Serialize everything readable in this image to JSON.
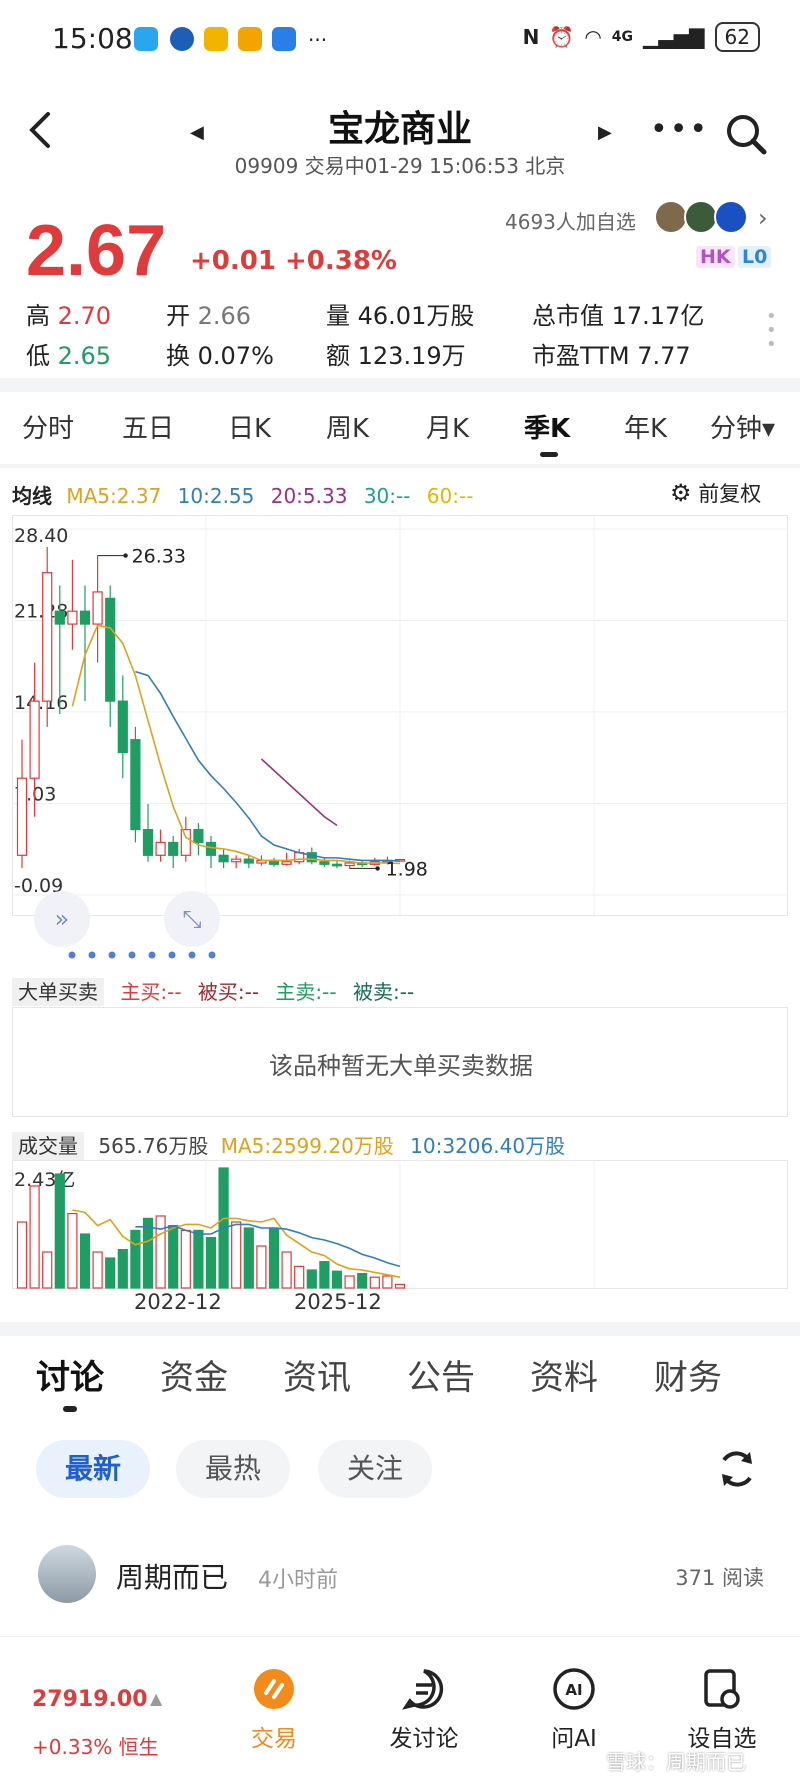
{
  "status": {
    "time": "15:08",
    "network": "4G",
    "battery": "62"
  },
  "header": {
    "title": "宝龙商业",
    "subtitle": "09909 交易中01-29 15:06:53 北京"
  },
  "quote": {
    "price": "2.67",
    "change": "+0.01 +0.38%",
    "followers": "4693人加自选",
    "badges": [
      "HK",
      "L0"
    ],
    "stats": {
      "high_label": "高",
      "high": "2.70",
      "open_label": "开",
      "open": "2.66",
      "volume_label": "量",
      "volume": "46.01万股",
      "mktcap_label": "总市值",
      "mktcap": "17.17亿",
      "low_label": "低",
      "low": "2.65",
      "turnover_label": "换",
      "turnover": "0.07%",
      "amount_label": "额",
      "amount": "123.19万",
      "pe_label": "市盈TTM",
      "pe": "7.77"
    }
  },
  "period_tabs": [
    "分时",
    "五日",
    "日K",
    "周K",
    "月K",
    "季K",
    "年K",
    "分钟▾"
  ],
  "active_period": "季K",
  "ma_legend": {
    "title": "均线",
    "ma5": "MA5:2.37",
    "ma10": "10:2.55",
    "ma20": "20:5.33",
    "ma30": "30:--",
    "ma60": "60:--",
    "adjust": "前复权"
  },
  "colors": {
    "up": "#e03a3a",
    "down": "#1e9e62",
    "ma5": "#e1a11a",
    "ma10": "#2f7fbf",
    "ma20": "#9b2f8f",
    "accent": "#1f5fcf"
  },
  "chart_data": {
    "type": "candlestick",
    "period": "quarterly",
    "y_ticks": [
      "28.40",
      "21.28",
      "14.16",
      "7.03",
      "-0.09"
    ],
    "ylim": [
      -0.09,
      28.4
    ],
    "annotations": {
      "max": "26.33",
      "min": "1.98"
    },
    "candles": [
      {
        "o": 3.0,
        "c": 9.0,
        "h": 12.0,
        "l": 2.0
      },
      {
        "o": 9.0,
        "c": 15.0,
        "h": 18.0,
        "l": 6.0
      },
      {
        "o": 15.0,
        "c": 25.0,
        "h": 27.0,
        "l": 13.0
      },
      {
        "o": 22.0,
        "c": 21.0,
        "h": 24.0,
        "l": 14.0
      },
      {
        "o": 21.0,
        "c": 22.0,
        "h": 26.0,
        "l": 19.0
      },
      {
        "o": 22.0,
        "c": 21.0,
        "h": 24.0,
        "l": 15.0
      },
      {
        "o": 21.0,
        "c": 23.5,
        "h": 26.33,
        "l": 18.0
      },
      {
        "o": 23.0,
        "c": 15.0,
        "h": 24.0,
        "l": 13.0
      },
      {
        "o": 15.0,
        "c": 11.0,
        "h": 17.0,
        "l": 9.0
      },
      {
        "o": 12.0,
        "c": 5.0,
        "h": 13.0,
        "l": 4.0
      },
      {
        "o": 5.0,
        "c": 3.0,
        "h": 7.0,
        "l": 2.5
      },
      {
        "o": 3.0,
        "c": 4.0,
        "h": 5.0,
        "l": 2.5
      },
      {
        "o": 4.0,
        "c": 3.0,
        "h": 4.5,
        "l": 2.0
      },
      {
        "o": 3.0,
        "c": 5.0,
        "h": 6.0,
        "l": 2.5
      },
      {
        "o": 5.0,
        "c": 4.0,
        "h": 5.5,
        "l": 3.0
      },
      {
        "o": 4.0,
        "c": 3.0,
        "h": 4.5,
        "l": 2.0
      },
      {
        "o": 3.0,
        "c": 2.5,
        "h": 3.5,
        "l": 2.0
      },
      {
        "o": 2.5,
        "c": 2.7,
        "h": 3.0,
        "l": 2.0
      },
      {
        "o": 2.7,
        "c": 2.4,
        "h": 3.0,
        "l": 2.0
      },
      {
        "o": 2.4,
        "c": 2.6,
        "h": 3.0,
        "l": 2.2
      },
      {
        "o": 2.6,
        "c": 2.3,
        "h": 2.8,
        "l": 2.1
      },
      {
        "o": 2.3,
        "c": 2.5,
        "h": 3.2,
        "l": 2.2
      },
      {
        "o": 2.5,
        "c": 3.2,
        "h": 3.5,
        "l": 2.3
      },
      {
        "o": 3.2,
        "c": 2.5,
        "h": 3.6,
        "l": 2.3
      },
      {
        "o": 2.5,
        "c": 2.3,
        "h": 2.8,
        "l": 2.1
      },
      {
        "o": 2.3,
        "c": 2.2,
        "h": 2.6,
        "l": 2.0
      },
      {
        "o": 2.2,
        "c": 2.4,
        "h": 2.6,
        "l": 1.98
      },
      {
        "o": 2.4,
        "c": 2.3,
        "h": 2.6,
        "l": 2.1
      },
      {
        "o": 2.3,
        "c": 2.5,
        "h": 2.8,
        "l": 2.2
      },
      {
        "o": 2.5,
        "c": 2.6,
        "h": 2.9,
        "l": 2.3
      },
      {
        "o": 2.66,
        "c": 2.67,
        "h": 2.7,
        "l": 2.65
      }
    ],
    "ma5": [
      null,
      null,
      null,
      null,
      14.6,
      18.6,
      20.9,
      20.7,
      19.5,
      17.0,
      13.5,
      10.0,
      6.8,
      4.4,
      3.8,
      3.6,
      3.5,
      3.3,
      3.0,
      2.6,
      2.6,
      2.6,
      2.7,
      2.7,
      2.6,
      2.6,
      2.5,
      2.4,
      2.4,
      2.4,
      2.37
    ],
    "ma10": [
      null,
      null,
      null,
      null,
      null,
      null,
      null,
      null,
      null,
      17.3,
      17.0,
      15.6,
      13.8,
      12.1,
      10.4,
      9.2,
      8.2,
      7.1,
      5.9,
      4.5,
      3.8,
      3.5,
      3.2,
      3.0,
      2.8,
      2.8,
      2.7,
      2.6,
      2.6,
      2.6,
      2.55
    ],
    "ma20": [
      null,
      null,
      null,
      null,
      null,
      null,
      null,
      null,
      null,
      null,
      null,
      null,
      null,
      null,
      null,
      null,
      null,
      null,
      null,
      10.5,
      9.6,
      8.7,
      7.8,
      6.9,
      6.0,
      5.33
    ],
    "x_labels": [
      "2022-12",
      "2025-12"
    ]
  },
  "big_orders": {
    "title": "大单买卖",
    "items": [
      "主买:--",
      "被买:--",
      "主卖:--",
      "被卖:--"
    ],
    "empty_text": "该品种暂无大单买卖数据"
  },
  "volume": {
    "title": "成交量",
    "current": "565.76万股",
    "ma5": "MA5:2599.20万股",
    "ma10": "10:3206.40万股",
    "max_label": "2.43亿",
    "bars": [
      0.55,
      0.85,
      0.3,
      0.95,
      0.62,
      0.45,
      0.3,
      0.25,
      0.32,
      0.48,
      0.58,
      0.6,
      0.52,
      0.48,
      0.48,
      0.42,
      1.0,
      0.55,
      0.5,
      0.35,
      0.5,
      0.3,
      0.18,
      0.15,
      0.22,
      0.14,
      0.1,
      0.12,
      0.09,
      0.1,
      0.03
    ],
    "ma5_line": [
      null,
      null,
      null,
      null,
      0.65,
      0.63,
      0.52,
      0.57,
      0.43,
      0.36,
      0.39,
      0.45,
      0.5,
      0.53,
      0.53,
      0.5,
      0.58,
      0.58,
      0.56,
      0.55,
      0.58,
      0.44,
      0.37,
      0.3,
      0.27,
      0.2,
      0.16,
      0.15,
      0.13,
      0.11,
      0.09
    ],
    "ma10_line": [
      null,
      null,
      null,
      null,
      null,
      null,
      null,
      null,
      null,
      0.51,
      0.51,
      0.49,
      0.52,
      0.48,
      0.45,
      0.45,
      0.5,
      0.53,
      0.53,
      0.5,
      0.5,
      0.49,
      0.46,
      0.42,
      0.4,
      0.37,
      0.33,
      0.28,
      0.25,
      0.21,
      0.18
    ]
  },
  "discussion_tabs": [
    "讨论",
    "资金",
    "资讯",
    "公告",
    "资料",
    "财务"
  ],
  "filter_chips": [
    "最新",
    "最热",
    "关注"
  ],
  "post": {
    "user": "周期而已",
    "time": "4小时前",
    "reads": "371 阅读"
  },
  "bottom_nav": {
    "index_value": "27919.00",
    "index_change": "+0.33% 恒生",
    "items": [
      "交易",
      "发讨论",
      "问AI",
      "设自选"
    ]
  },
  "watermark": "雪球：周期而已"
}
